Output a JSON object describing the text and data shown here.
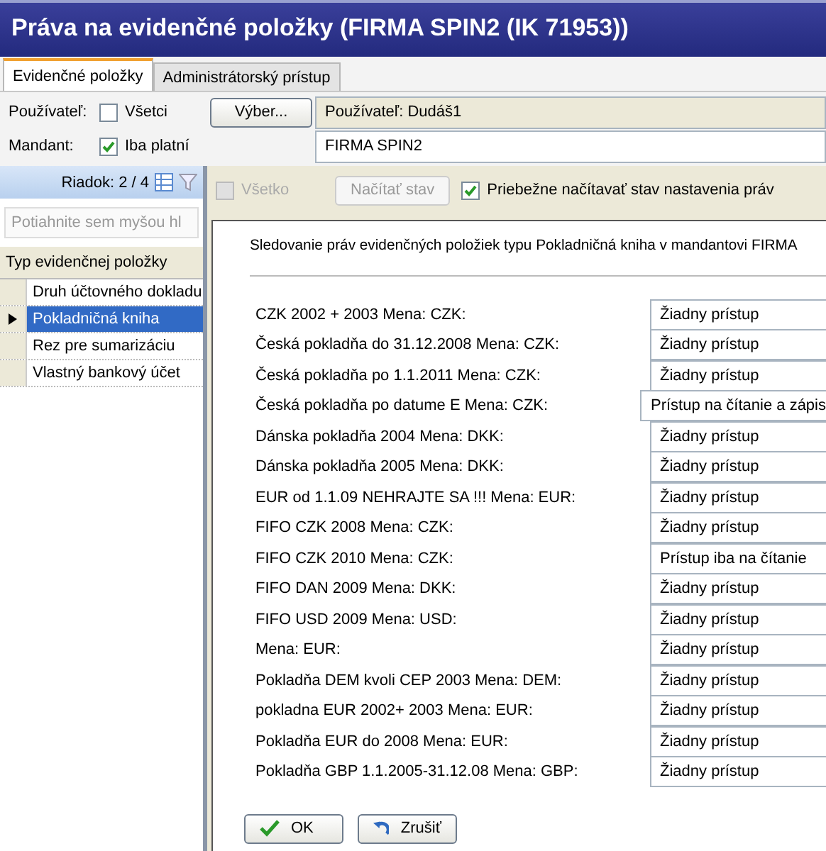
{
  "window": {
    "title": "Práva na evidenčné položky (FIRMA SPIN2 (IK 71953))"
  },
  "tabs": [
    {
      "label": "Evidenčné položky",
      "selected": true
    },
    {
      "label": "Administrátorský prístup",
      "selected": false
    }
  ],
  "user_row": {
    "label": "Používateľ:",
    "all_checkbox": {
      "label": "Všetci",
      "checked": false
    },
    "select_button": "Výber...",
    "user_field": "Používateľ: Dudáš1"
  },
  "mandant_row": {
    "label": "Mandant:",
    "valid_checkbox": {
      "label": "Iba platní",
      "checked": true
    },
    "mandant_field": "FIRMA SPIN2"
  },
  "grid": {
    "row_indicator": "Riadok: 2 / 4",
    "group_placeholder": "Potiahnite sem myšou hl",
    "column": "Typ evidenčnej položky",
    "rows": [
      {
        "label": "Druh účtovného dokladu",
        "selected": false
      },
      {
        "label": "Pokladničná kniha",
        "selected": true
      },
      {
        "label": "Rez pre sumarizáciu",
        "selected": false
      },
      {
        "label": "Vlastný bankový účet",
        "selected": false
      }
    ]
  },
  "toolbar": {
    "all_checkbox": {
      "label": "Všetko",
      "checked": false,
      "disabled": true
    },
    "load_button": {
      "label": "Načítať stav",
      "disabled": true
    },
    "auto_checkbox": {
      "label": "Priebežne načítavať stav nastavenia práv",
      "checked": true,
      "disabled": false
    }
  },
  "description": "Sledovanie práv evidenčných položiek typu Pokladničná kniha v mandantovi FIRMA",
  "permissions": [
    {
      "label": "CZK 2002 + 2003 Mena: CZK:",
      "value": "Žiadny prístup"
    },
    {
      "label": "Česká pokladňa do 31.12.2008 Mena: CZK:",
      "value": "Žiadny prístup"
    },
    {
      "label": "Česká pokladňa po 1.1.2011 Mena: CZK:",
      "value": "Žiadny prístup"
    },
    {
      "label": "Česká pokladňa po datume E Mena: CZK:",
      "value": "Prístup na čítanie a zápis"
    },
    {
      "label": "Dánska pokladňa 2004  Mena: DKK:",
      "value": "Žiadny prístup"
    },
    {
      "label": "Dánska pokladňa 2005 Mena: DKK:",
      "value": "Žiadny prístup"
    },
    {
      "label": "EUR od 1.1.09 NEHRAJTE SA !!! Mena: EUR:",
      "value": "Žiadny prístup"
    },
    {
      "label": "FIFO CZK 2008 Mena: CZK:",
      "value": "Žiadny prístup"
    },
    {
      "label": "FIFO CZK 2010 Mena: CZK:",
      "value": "Prístup iba na čítanie"
    },
    {
      "label": "FIFO DAN 2009 Mena: DKK:",
      "value": "Žiadny prístup"
    },
    {
      "label": "FIFO USD 2009 Mena: USD:",
      "value": "Žiadny prístup"
    },
    {
      "label": "Mena: EUR:",
      "value": "Žiadny prístup"
    },
    {
      "label": "Pokladňa DEM kvoli CEP 2003 Mena: DEM:",
      "value": "Žiadny prístup"
    },
    {
      "label": "pokladna EUR 2002+ 2003 Mena: EUR:",
      "value": "Žiadny prístup"
    },
    {
      "label": "Pokladňa EUR do 2008 Mena: EUR:",
      "value": "Žiadny prístup"
    },
    {
      "label": "Pokladňa GBP 1.1.2005-31.12.08 Mena: GBP:",
      "value": "Žiadny prístup"
    }
  ],
  "buttons": [
    {
      "label": "OK",
      "kind": "ok"
    },
    {
      "label": "Zrušiť",
      "kind": "cancel"
    }
  ]
}
